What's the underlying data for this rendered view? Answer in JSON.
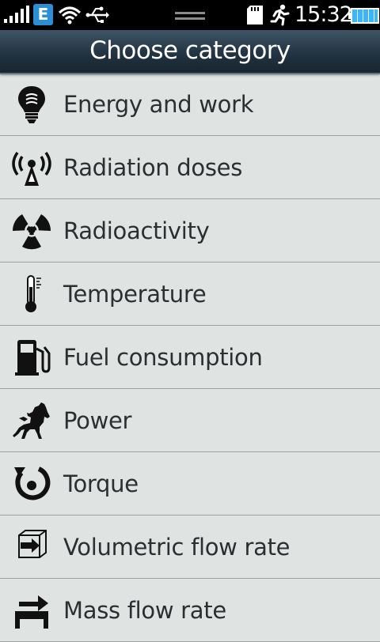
{
  "status_bar": {
    "network_badge": "E",
    "time": "15:32"
  },
  "header": {
    "title": "Choose category"
  },
  "categories": [
    {
      "label": "Energy and work",
      "icon": "lightbulb-icon"
    },
    {
      "label": "Radiation doses",
      "icon": "radiation-antenna-icon"
    },
    {
      "label": "Radioactivity",
      "icon": "radioactive-icon"
    },
    {
      "label": "Temperature",
      "icon": "thermometer-icon"
    },
    {
      "label": "Fuel consumption",
      "icon": "fuel-pump-icon"
    },
    {
      "label": "Power",
      "icon": "horse-icon"
    },
    {
      "label": "Torque",
      "icon": "torque-icon"
    },
    {
      "label": "Volumetric flow rate",
      "icon": "volume-flow-icon"
    },
    {
      "label": "Mass flow rate",
      "icon": "mass-flow-icon"
    }
  ],
  "colors": {
    "background": "#dfe3e1",
    "title_bar": "#20313f",
    "network_badge": "#2a8fd6",
    "battery": "#3ab6ff"
  }
}
